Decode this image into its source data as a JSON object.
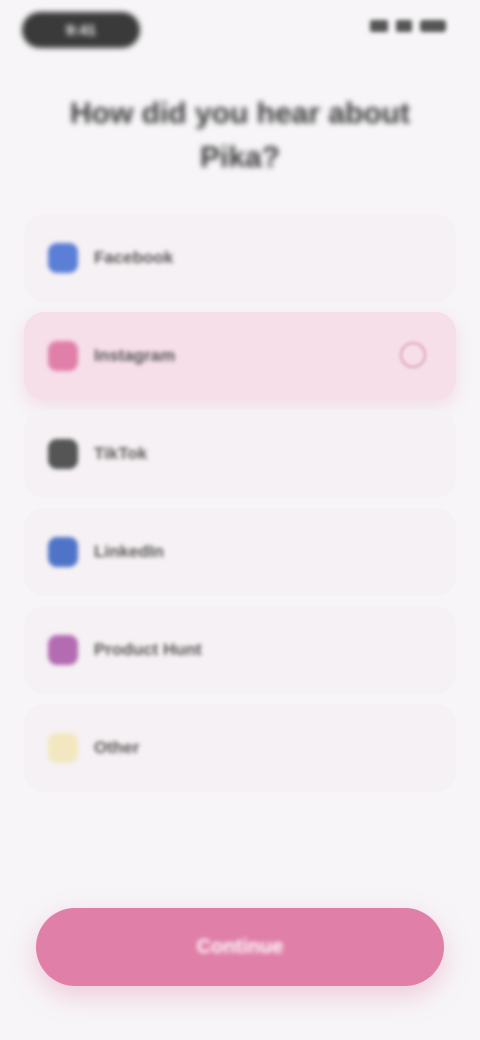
{
  "status_bar": {
    "time": "9:41",
    "icons": [
      "signal-icon",
      "wifi-icon",
      "battery-icon"
    ]
  },
  "title": "How did you hear about Pika?",
  "options": [
    {
      "label": "Facebook",
      "icon": "facebook-icon",
      "color": "#5b7fd6",
      "selected": false
    },
    {
      "label": "Instagram",
      "icon": "instagram-icon",
      "color": "#e07fa8",
      "selected": true
    },
    {
      "label": "TikTok",
      "icon": "tiktok-icon",
      "color": "#555555",
      "selected": false
    },
    {
      "label": "LinkedIn",
      "icon": "linkedin-icon",
      "color": "#4f74c7",
      "selected": false
    },
    {
      "label": "Product Hunt",
      "icon": "product-hunt-icon",
      "color": "#b36bb2",
      "selected": false
    },
    {
      "label": "Other",
      "icon": "other-icon",
      "color": "#f3e7bf",
      "selected": false
    }
  ],
  "continue_button": {
    "label": "Continue"
  },
  "colors": {
    "accent": "#e07fa8",
    "background": "#f7f5f7",
    "selected_row": "#f7dfe9"
  }
}
